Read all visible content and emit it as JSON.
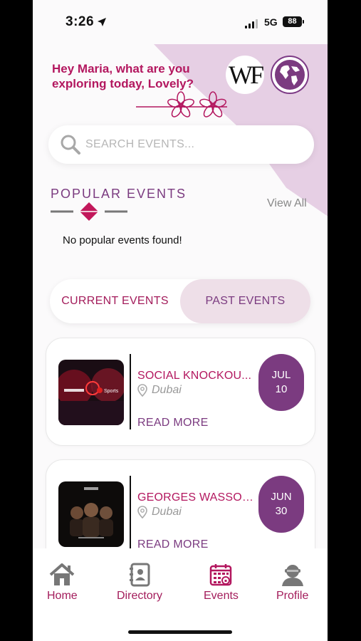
{
  "status_bar": {
    "time": "3:26",
    "network": "5G",
    "battery": "88"
  },
  "header": {
    "greeting": "Hey Maria, what are you exploring today, Lovely?",
    "logo_text": "WF"
  },
  "search": {
    "placeholder": "SEARCH EVENTS..."
  },
  "popular": {
    "title": "POPULAR EVENTS",
    "view_all": "View All",
    "empty_message": "No popular events found!"
  },
  "tabs": [
    {
      "label": "CURRENT EVENTS",
      "active": false
    },
    {
      "label": "PAST EVENTS",
      "active": true
    }
  ],
  "events": [
    {
      "title": "SOCIAL KNOCKOU...",
      "location": "Dubai",
      "month": "JUL",
      "day": "10",
      "read_more": "READ MORE",
      "thumb_text": "Sports"
    },
    {
      "title": "GEORGES WASSOU...",
      "location": "Dubai",
      "month": "JUN",
      "day": "30",
      "read_more": "READ MORE"
    }
  ],
  "nav": [
    {
      "label": "Home",
      "icon": "home-icon"
    },
    {
      "label": "Directory",
      "icon": "directory-icon"
    },
    {
      "label": "Events",
      "icon": "calendar-icon"
    },
    {
      "label": "Profile",
      "icon": "profile-icon"
    }
  ],
  "colors": {
    "primary": "#7b3b80",
    "accent": "#b3175f",
    "blob": "#e6cfe4"
  }
}
